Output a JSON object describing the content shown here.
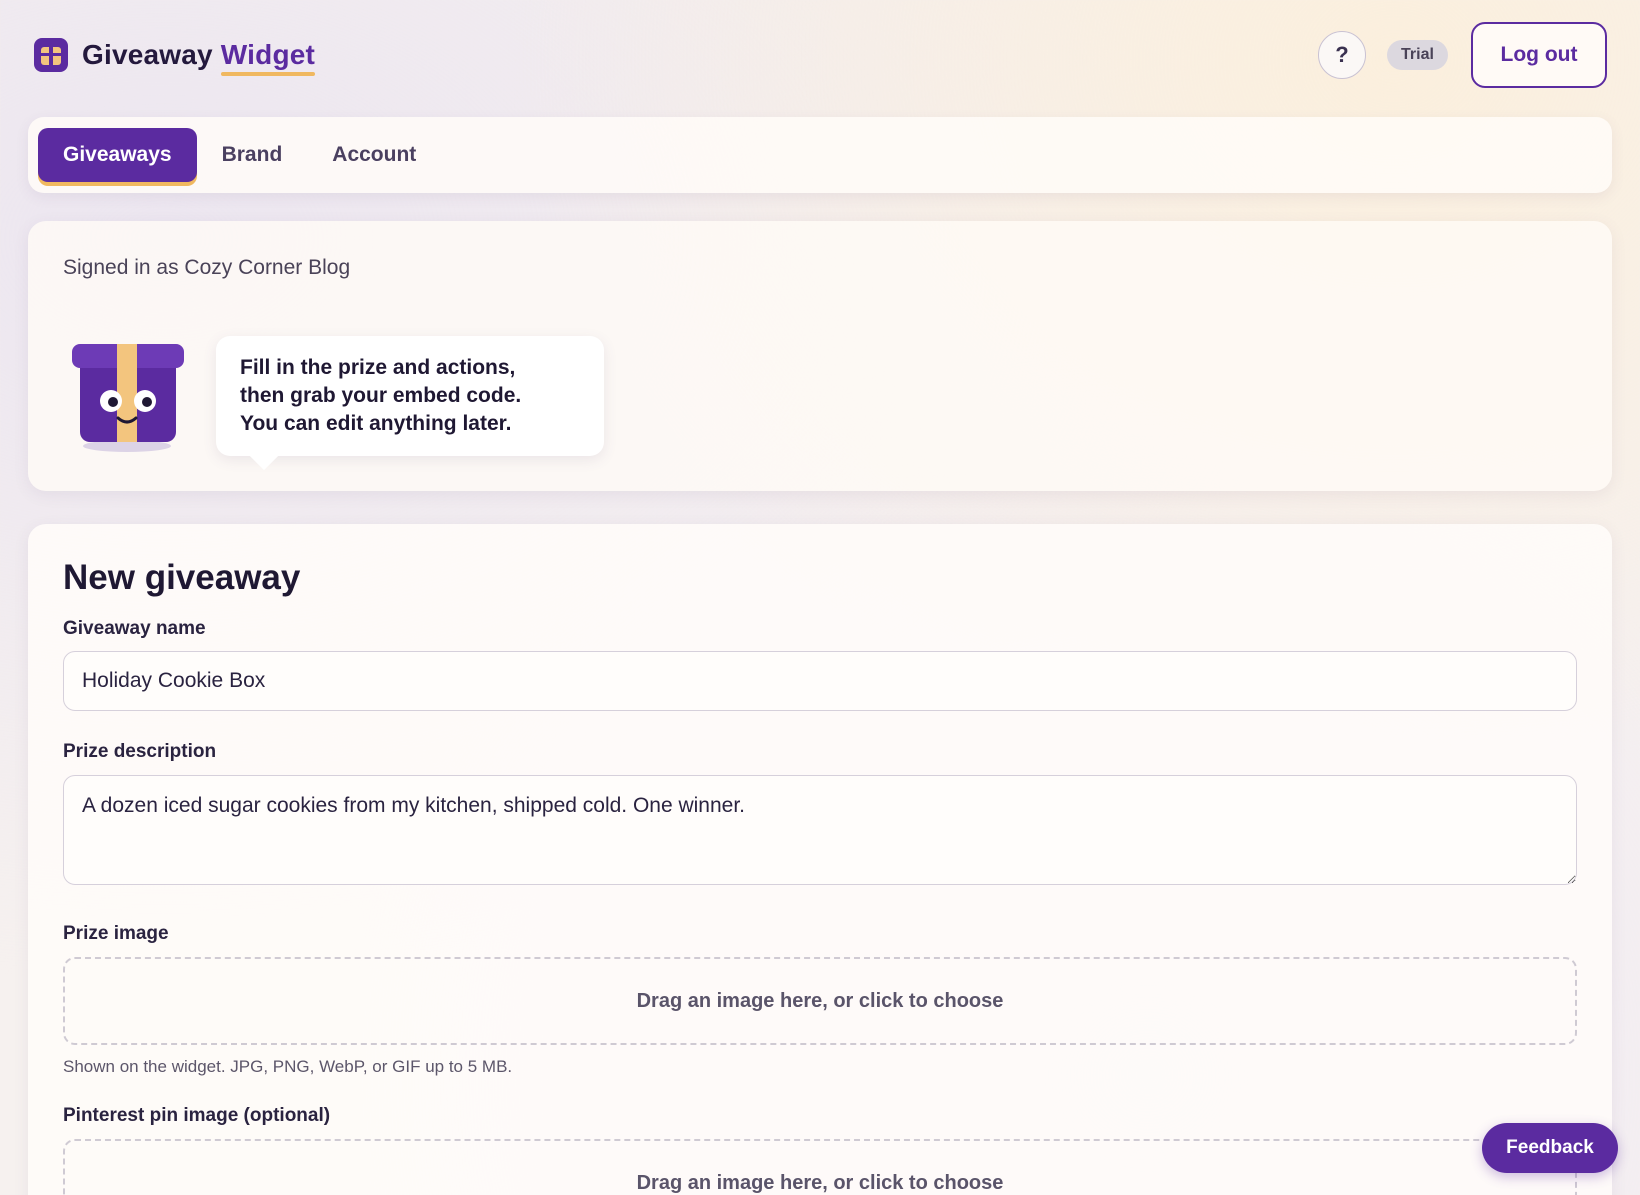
{
  "header": {
    "logo_word1": "Giveaway",
    "logo_word2": "Widget",
    "help_label": "?",
    "plan_badge": "Trial",
    "logout_label": "Log out"
  },
  "nav": {
    "tabs": [
      {
        "label": "Giveaways",
        "active": true
      },
      {
        "label": "Brand",
        "active": false
      },
      {
        "label": "Account",
        "active": false
      }
    ]
  },
  "welcome": {
    "signed_in": "Signed in as Cozy Corner Blog",
    "bubble": "Fill in the prize and actions,\nthen grab your embed code.\nYou can edit anything later."
  },
  "form": {
    "title": "New giveaway",
    "name_label": "Giveaway name",
    "name_value": "Holiday Cookie Box",
    "description_label": "Prize description",
    "description_value": "A dozen iced sugar cookies from my kitchen, shipped cold. One winner.",
    "prize_image_label": "Prize image",
    "prize_image_drop": "Drag an image here, or click to choose",
    "prize_image_hint": "Shown on the widget. JPG, PNG, WebP, or GIF up to 5 MB.",
    "pin_image_label": "Pinterest pin image (optional)",
    "pin_image_drop": "Drag an image here, or click to choose"
  },
  "feedback_label": "Feedback",
  "colors": {
    "brand": "#5b2ba0",
    "accent": "#f0b860"
  }
}
